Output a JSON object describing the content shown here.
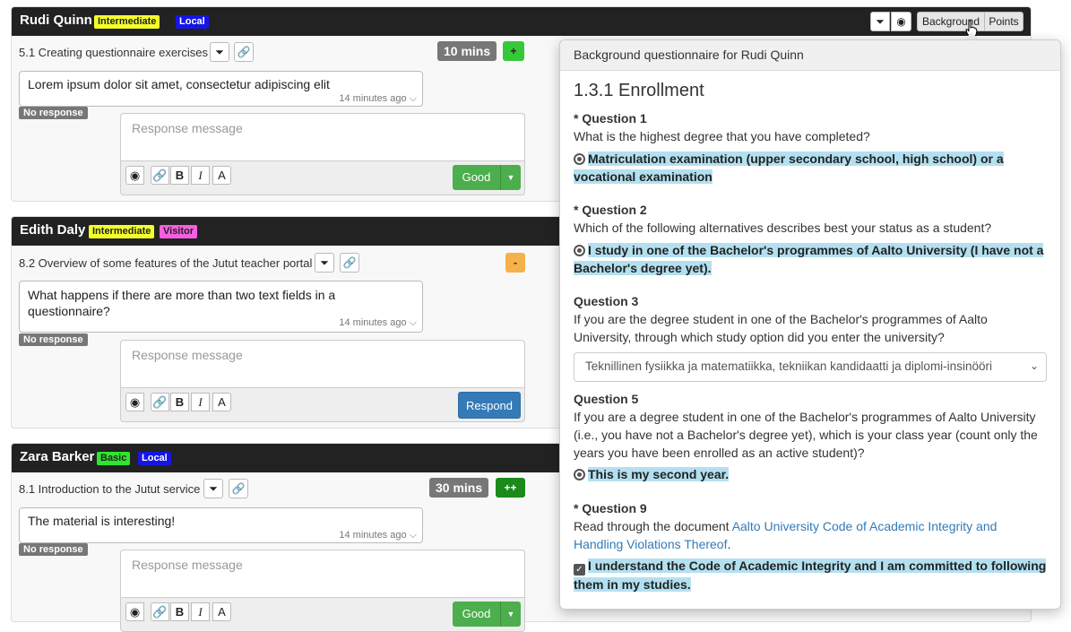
{
  "header_buttons": {
    "background": "Background",
    "points": "Points"
  },
  "icons": {
    "filter": "filter-icon",
    "eye": "eye-icon",
    "link": "link-icon",
    "bold": "bold-icon",
    "italic": "italic-icon",
    "text": "text-icon",
    "cursor": "hand-cursor-icon"
  },
  "cards": [
    {
      "name": "Rudi Quinn",
      "tags": [
        {
          "label": "Intermediate",
          "color": "#f5ff2a"
        },
        {
          "label": "Local",
          "color": "#1515e6"
        }
      ],
      "exercise": "5.1 Creating questionnaire exercises",
      "mins": "10 mins",
      "points": "+",
      "answer": "Lorem ipsum dolor sit amet, consectetur adipiscing elit",
      "answer_time": "14 minutes ago",
      "status": "No response",
      "placeholder": "Response message",
      "action": "Good"
    },
    {
      "name": "Edith Daly",
      "tags": [
        {
          "label": "Intermediate",
          "color": "#f5ff2a"
        },
        {
          "label": "Visitor",
          "color": "#f55fe0"
        }
      ],
      "exercise": "8.2 Overview of some features of the Jutut teacher portal",
      "mins": "",
      "points": "-",
      "answer": "What happens if there are more than two text fields in a questionnaire?",
      "answer_time": "14 minutes ago",
      "status": "No response",
      "placeholder": "Response message",
      "action": "Respond"
    },
    {
      "name": "Zara Barker",
      "tags": [
        {
          "label": "Basic",
          "color": "#2ee62e"
        },
        {
          "label": "Local",
          "color": "#1515e6"
        }
      ],
      "exercise": "8.1 Introduction to the Jutut service",
      "mins": "30 mins",
      "points": "++",
      "answer": "The material is interesting!",
      "answer_time": "14 minutes ago",
      "status": "No response",
      "placeholder": "Response message",
      "action": "Good"
    }
  ],
  "popover": {
    "title": "Background questionnaire for Rudi Quinn",
    "section": "1.3.1 Enrollment",
    "questions": [
      {
        "label": "* Question 1",
        "text": "What is the highest degree that you have completed?",
        "answer": "Matriculation examination (upper secondary school, high school) or a vocational examination"
      },
      {
        "label": "* Question 2",
        "text": "Which of the following alternatives describes best your status as a student?",
        "answer": "I study in one of the Bachelor's programmes of Aalto University (I have not a Bachelor's degree yet)."
      },
      {
        "label": "Question 3",
        "text": "If you are the degree student in one of the Bachelor's programmes of Aalto University, through which study option did you enter the university?",
        "select_value": "Teknillinen fysiikka ja matematiikka, tekniikan kandidaatti ja diplomi-insinööri"
      },
      {
        "label": "Question 5",
        "text": "If you are a degree student in one of the Bachelor's programmes of Aalto University (i.e., you have not a Bachelor's degree yet), which is your class year (count only the years you have been enrolled as an active student)?",
        "answer": "This is my second year."
      },
      {
        "label": "* Question 9",
        "text_prefix": "Read through the document ",
        "link": "Aalto University Code of Academic Integrity and Handling Violations Thereof",
        "text_suffix": ".",
        "answer": "I understand the Code of Academic Integrity and I am committed to following them in my studies."
      }
    ]
  }
}
